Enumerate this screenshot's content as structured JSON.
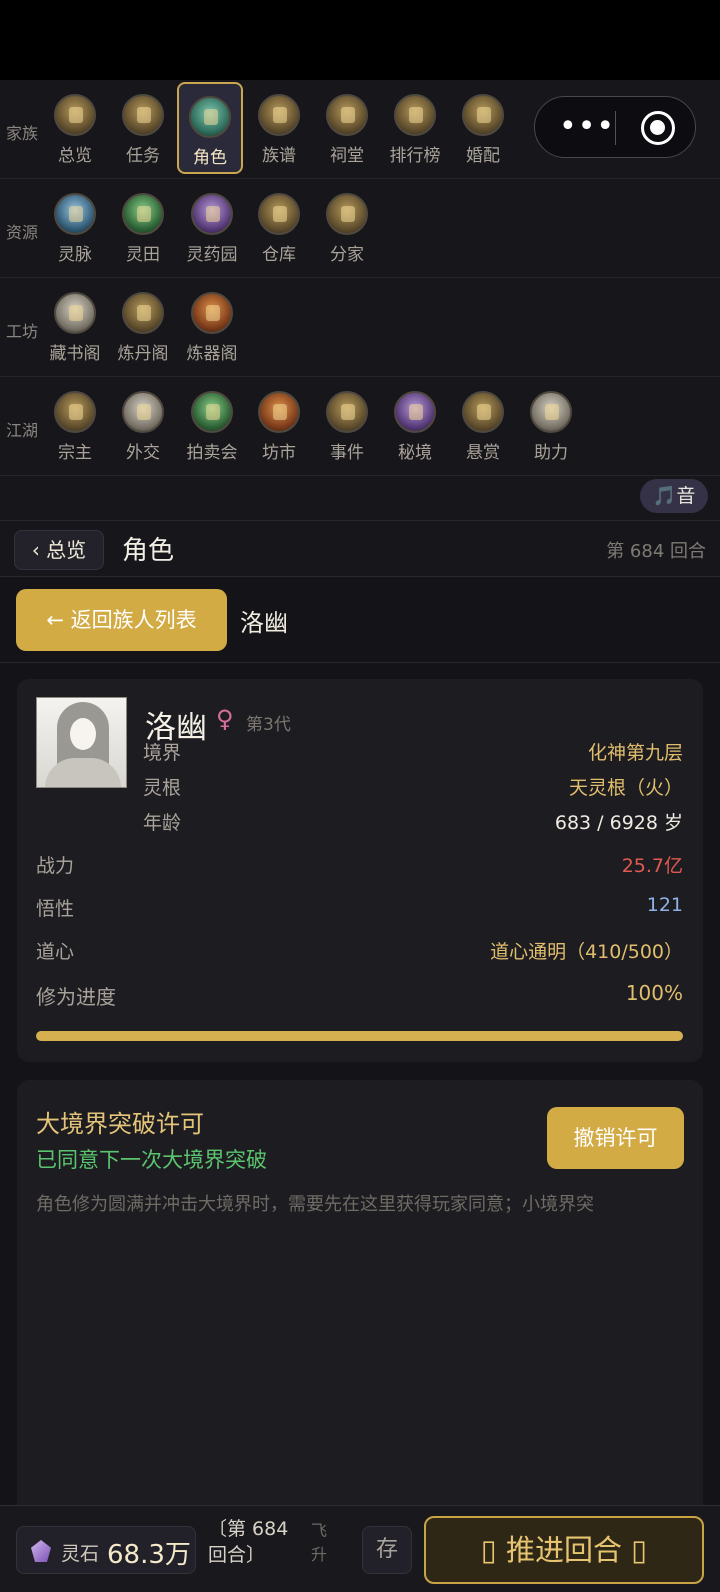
{
  "nav": {
    "rows": [
      {
        "label": "家族",
        "items": [
          {
            "label": "总览",
            "icon": "overview-icon"
          },
          {
            "label": "任务",
            "icon": "task-icon"
          },
          {
            "label": "角色",
            "icon": "character-icon",
            "active": true
          },
          {
            "label": "族谱",
            "icon": "family-tree-icon"
          },
          {
            "label": "祠堂",
            "icon": "shrine-icon"
          },
          {
            "label": "排行榜",
            "icon": "ranking-icon"
          },
          {
            "label": "婚配",
            "icon": "marriage-icon"
          }
        ]
      },
      {
        "label": "资源",
        "items": [
          {
            "label": "灵脉",
            "icon": "spirit-vein-icon"
          },
          {
            "label": "灵田",
            "icon": "spirit-field-icon"
          },
          {
            "label": "灵药园",
            "icon": "herb-garden-icon"
          },
          {
            "label": "仓库",
            "icon": "warehouse-icon"
          },
          {
            "label": "分家",
            "icon": "branch-family-icon"
          }
        ]
      },
      {
        "label": "工坊",
        "items": [
          {
            "label": "藏书阁",
            "icon": "library-icon"
          },
          {
            "label": "炼丹阁",
            "icon": "alchemy-icon"
          },
          {
            "label": "炼器阁",
            "icon": "forge-icon"
          }
        ]
      },
      {
        "label": "江湖",
        "items": [
          {
            "label": "宗主",
            "icon": "sect-master-icon"
          },
          {
            "label": "外交",
            "icon": "diplomacy-icon"
          },
          {
            "label": "拍卖会",
            "icon": "auction-icon"
          },
          {
            "label": "坊市",
            "icon": "market-icon"
          },
          {
            "label": "事件",
            "icon": "event-icon"
          },
          {
            "label": "秘境",
            "icon": "secret-realm-icon"
          },
          {
            "label": "悬赏",
            "icon": "bounty-icon"
          },
          {
            "label": "助力",
            "icon": "assist-icon"
          }
        ]
      }
    ]
  },
  "capsule": {
    "more": "•••"
  },
  "music": {
    "label": "🎵音"
  },
  "titlebar": {
    "back": "‹ 总览",
    "title": "角色",
    "turn": "第 684 回合"
  },
  "sub": {
    "back": "← 返回族人列表",
    "name": "洛幽"
  },
  "character": {
    "name": "洛幽",
    "gender": "♀",
    "generation": "第3代",
    "stats": [
      {
        "label": "境界",
        "value": "化神第九层",
        "color": "#e1be6d"
      },
      {
        "label": "灵根",
        "value": "天灵根（火）",
        "color": "#e1be6d"
      },
      {
        "label": "年龄",
        "value": "683 / 6928 岁",
        "color": "#efebe2"
      }
    ],
    "attrs": [
      {
        "label": "战力",
        "value": "25.7亿",
        "color": "#e05a52"
      },
      {
        "label": "悟性",
        "value": "121",
        "color": "#8fb3e8"
      },
      {
        "label": "道心",
        "value": "道心通明（410/500）",
        "color": "#e1be6d"
      }
    ],
    "progress": {
      "label": "修为进度",
      "value": "100%",
      "percent": 100
    }
  },
  "permit": {
    "title": "大境界突破许可",
    "status": "已同意下一次大境界突破",
    "button": "撤销许可",
    "desc": "角色修为圆满并冲击大境界时，需要先在这里获得玩家同意；小境界突"
  },
  "bottom": {
    "stone_label": "灵石",
    "stone_value": "68.3万",
    "turn_line1": "〔第 684",
    "turn_line2": "回合〕",
    "fly_1": "飞",
    "fly_2": "升",
    "save": "存",
    "advance": "▯  推进回合 ▯"
  }
}
